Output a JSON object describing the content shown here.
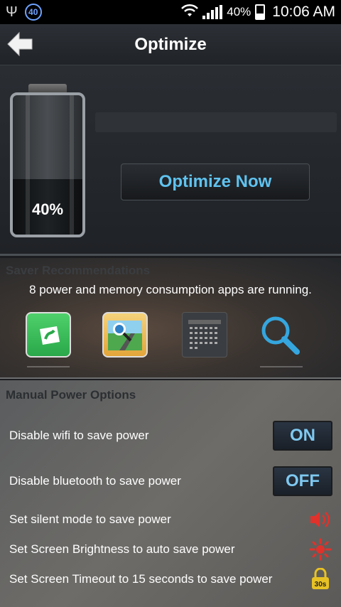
{
  "status_bar": {
    "notification_badge": "40",
    "battery_percent": "40%",
    "time": "10:06 AM"
  },
  "header": {
    "title": "Optimize"
  },
  "battery": {
    "level_text": "40%",
    "level_fraction": 0.4
  },
  "optimize": {
    "button_label": "Optimize Now"
  },
  "recommendations": {
    "title": "Saver Recommendations",
    "message": "8 power and memory consumption apps are running.",
    "apps": [
      {
        "name": "saavn-app-icon"
      },
      {
        "name": "maps-app-icon"
      },
      {
        "name": "calendar-app-icon"
      },
      {
        "name": "search-app-icon"
      }
    ]
  },
  "manual": {
    "title": "Manual Power Options",
    "options": [
      {
        "label": "Disable wifi to save power",
        "state": "ON"
      },
      {
        "label": "Disable bluetooth to save power",
        "state": "OFF"
      },
      {
        "label": "Set silent mode to save power",
        "icon": "speaker-icon"
      },
      {
        "label": "Set Screen Brightness to auto save power",
        "icon": "brightness-icon"
      },
      {
        "label": "Set Screen Timeout to 15 seconds to save power",
        "icon": "timeout-lock-icon",
        "icon_text": "30s"
      }
    ]
  },
  "colors": {
    "accent": "#5fc3f0",
    "silent_icon": "#e0322b",
    "timeout_icon": "#e8c224"
  }
}
